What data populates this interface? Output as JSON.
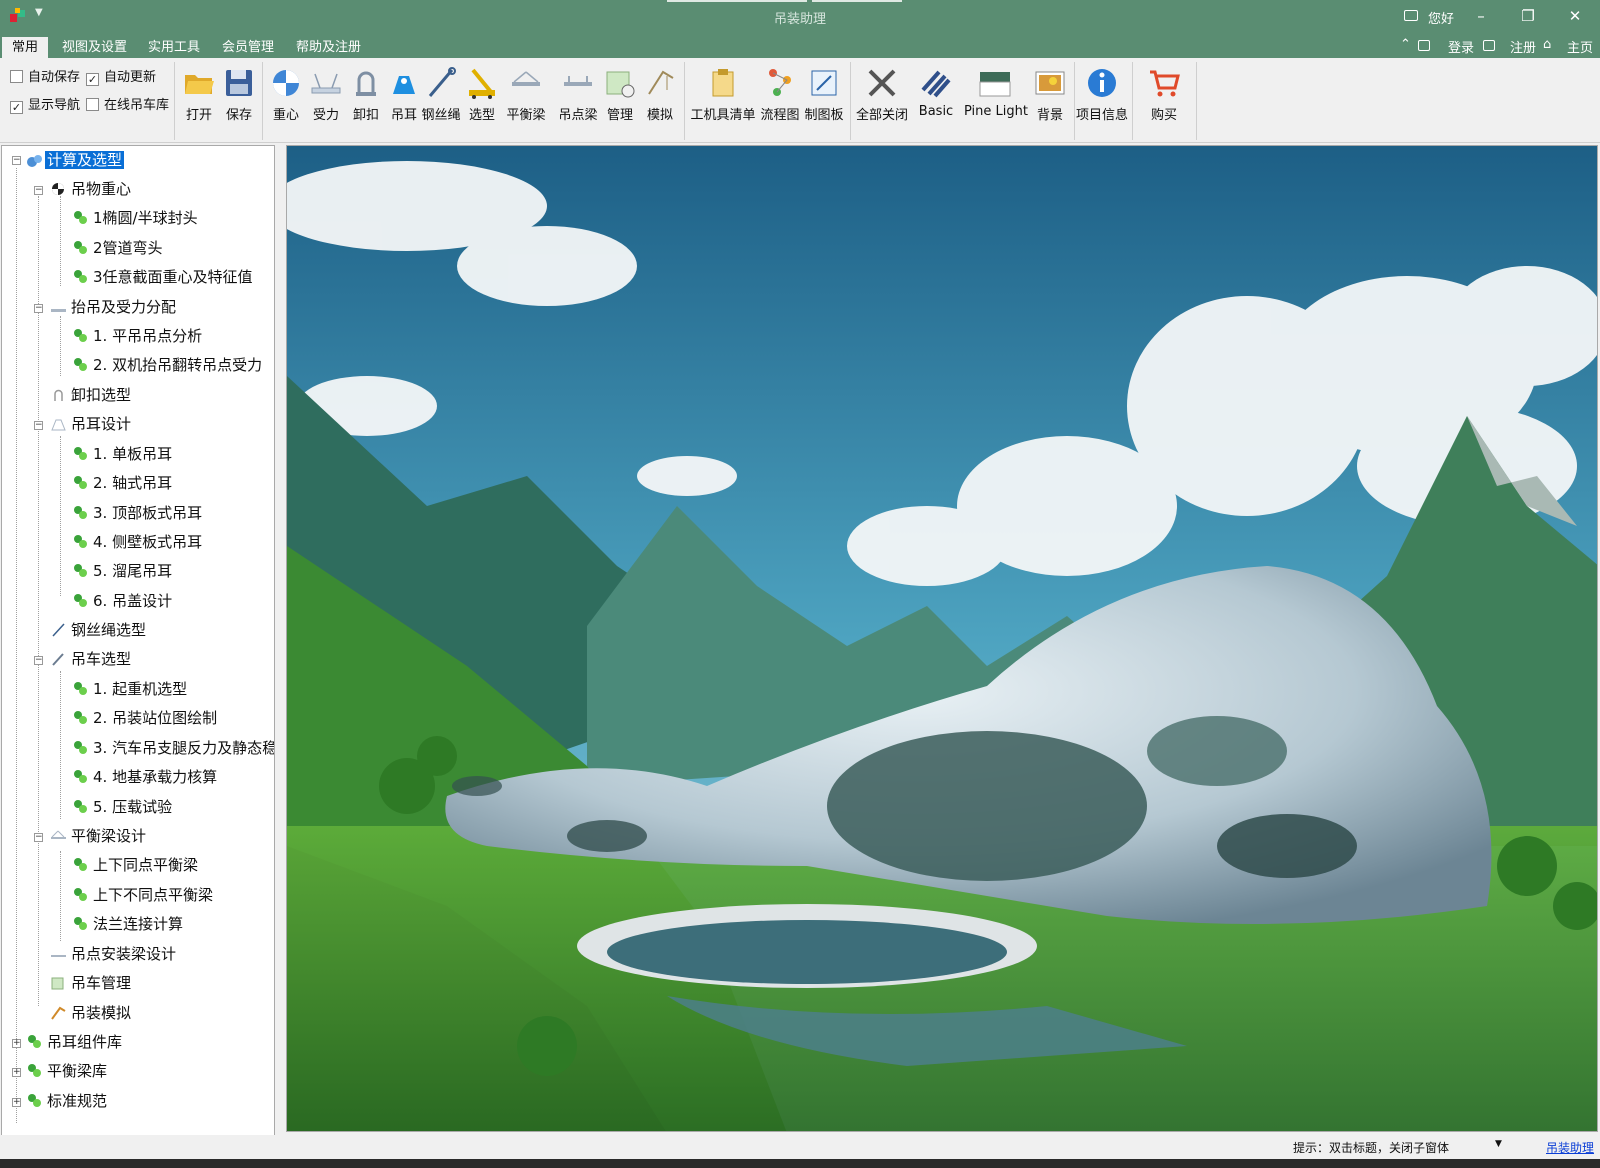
{
  "window": {
    "title": "吊装助理",
    "greeting": "您好",
    "minimize": "–",
    "restore": "❐",
    "close": "✕"
  },
  "menu": {
    "tabs": [
      "常用",
      "视图及设置",
      "实用工具",
      "会员管理",
      "帮助及注册"
    ],
    "active": "常用",
    "right": {
      "login": "登录",
      "register": "注册",
      "home": "主页"
    }
  },
  "options": {
    "auto_save": "自动保存",
    "auto_update": "自动更新",
    "show_nav": "显示导航",
    "online_crane_lib": "在线吊车库",
    "auto_save_checked": false,
    "auto_update_checked": true,
    "show_nav_checked": true,
    "online_crane_lib_checked": false
  },
  "ribbon": {
    "open": "打开",
    "save": "保存",
    "center": "重心",
    "force": "受力",
    "shackle": "卸扣",
    "lug": "吊耳",
    "rope": "钢丝绳",
    "select": "选型",
    "beam": "平衡梁",
    "lift_beam": "吊点梁",
    "manage": "管理",
    "simulate": "模拟",
    "tool_list": "工机具清单",
    "flowchart": "流程图",
    "drawing": "制图板",
    "close_all": "全部关闭",
    "basic": "Basic",
    "theme": "Pine Light",
    "background": "背景",
    "project_info": "项目信息",
    "buy": "购买"
  },
  "tree": {
    "root": "计算及选型",
    "n1": "吊物重心",
    "n1a": "1椭圆/半球封头",
    "n1b": "2管道弯头",
    "n1c": "3任意截面重心及特征值",
    "n2": "抬吊及受力分配",
    "n2a": "1. 平吊吊点分析",
    "n2b": "2. 双机抬吊翻转吊点受力",
    "n3": "卸扣选型",
    "n4": "吊耳设计",
    "n4a": "1. 单板吊耳",
    "n4b": "2. 轴式吊耳",
    "n4c": "3. 顶部板式吊耳",
    "n4d": "4. 侧壁板式吊耳",
    "n4e": "5. 溜尾吊耳",
    "n4f": "6. 吊盖设计",
    "n5": "钢丝绳选型",
    "n6": "吊车选型",
    "n6a": "1. 起重机选型",
    "n6b": "2. 吊装站位图绘制",
    "n6c": "3. 汽车吊支腿反力及静态稳",
    "n6d": "4. 地基承载力核算",
    "n6e": "5. 压载试验",
    "n7": "平衡梁设计",
    "n7a": "上下同点平衡梁",
    "n7b": "上下不同点平衡梁",
    "n7c": "法兰连接计算",
    "n8": "吊点安装梁设计",
    "n9": "吊车管理",
    "n10": "吊装模拟",
    "r2": "吊耳组件库",
    "r3": "平衡梁库",
    "r4": "标准规范"
  },
  "status": {
    "hint": "提示：双击标题，关闭子窗体",
    "link": "吊装助理"
  },
  "colors": {
    "titlebar": "#5a8d72",
    "selection": "#0a6fd6"
  }
}
